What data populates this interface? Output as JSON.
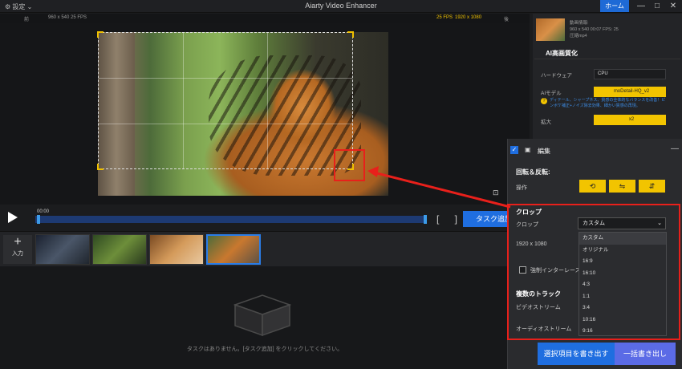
{
  "titlebar": {
    "title": "Aiarty Video Enhancer",
    "settings_label": "設定",
    "home_label": "ホーム",
    "win_minimize": "—",
    "win_maximize": "□",
    "win_close": "✕"
  },
  "preview": {
    "left_info": "960 x 540  25 FPS",
    "before_label": "前",
    "right_info_fps": "25 FPS",
    "right_info_res": "1920 x 1080",
    "after_label": "後"
  },
  "timeline": {
    "time": "00:00",
    "task_add": "タスク追加",
    "brackets": "[ ]"
  },
  "input": {
    "plus": "+",
    "label": "入力"
  },
  "queue": {
    "empty_message": "タスクはありません。[タスク追加] をクリックしてください。"
  },
  "right_panel": {
    "file_info_line1": "動画情報:",
    "file_info_line2": "960 x 540  00:07  FPS: 25",
    "file_info_line3": "圧縮mp4",
    "ai_title": "AI高画質化",
    "hardware_label": "ハードウェア",
    "hardware_value": "CPU",
    "ai_model_label": "AIモデル",
    "ai_model_value": "moDetail-HQ_v2",
    "ai_note": "ディテール、シャープネス、質感の全体的なバランスを改善！ピンボケ補正+ノイズ除去効果、細かい質感の再現。",
    "scale_label": "拡大",
    "scale_value": "x2"
  },
  "edit_panel": {
    "title": "編集",
    "rotate_title": "回転＆反転:",
    "operation_label": "操作",
    "crop_title": "クロップ",
    "crop_label": "クロップ",
    "crop_value": "カスタム",
    "resolution": "1920 x 1080",
    "interlace_label": "強制インターレース",
    "multi_track_title": "複数のトラック",
    "video_stream_label": "ビデオストリーム",
    "audio_stream_label": "オーディオストリーム",
    "crop_options": [
      "カスタム",
      "オリジナル",
      "16:9",
      "16:10",
      "4:3",
      "1:1",
      "3:4",
      "10:16",
      "9:16"
    ]
  },
  "actions": {
    "export_selected": "選択項目を書き出す",
    "export_all": "一括書き出し"
  },
  "colors": {
    "accent": "#1f6ee0",
    "highlight": "#e8201b",
    "yellow": "#f2c400"
  }
}
